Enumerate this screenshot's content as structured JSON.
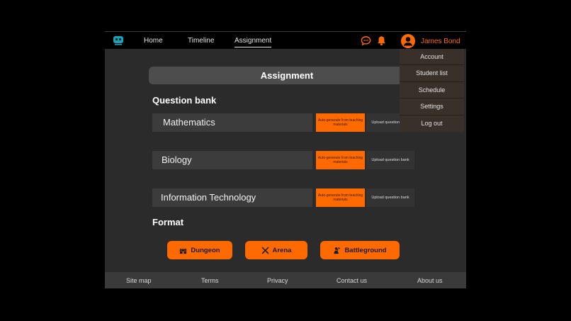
{
  "nav": {
    "home": "Home",
    "timeline": "Timeline",
    "assignment": "Assignment",
    "user_name": "James Bond"
  },
  "dropdown": {
    "items": [
      "Account",
      "Student list",
      "Schedule",
      "Settings",
      "Log out"
    ]
  },
  "main": {
    "title": "Assignment",
    "question_bank_heading": "Question bank",
    "subjects": [
      {
        "name": "Mathematics",
        "auto_label": "Auto-generate from teaching materials",
        "upload_label": "Upload question bank"
      },
      {
        "name": "Biology",
        "auto_label": "Auto-generate from teaching materials",
        "upload_label": "Upload question bank"
      },
      {
        "name": "Information Technology",
        "auto_label": "Auto-generate from teaching materials",
        "upload_label": "Upload question bank"
      }
    ],
    "format_heading": "Format",
    "formats": [
      "Dungeon",
      "Arena",
      "Battleground"
    ]
  },
  "footer": {
    "links": [
      "Site map",
      "Terms",
      "Privacy",
      "Contact us",
      "About us"
    ]
  },
  "colors": {
    "accent": "#ff6a00",
    "background": "#2b2b2b",
    "nav_background": "#000000"
  },
  "icons": {
    "logo": "logo-icon",
    "chat": "chat-bubble-icon",
    "notifications": "bell-icon",
    "avatar": "user-avatar-icon",
    "dungeon": "castle-icon",
    "arena": "crossed-swords-icon",
    "battleground": "soldier-icon"
  }
}
